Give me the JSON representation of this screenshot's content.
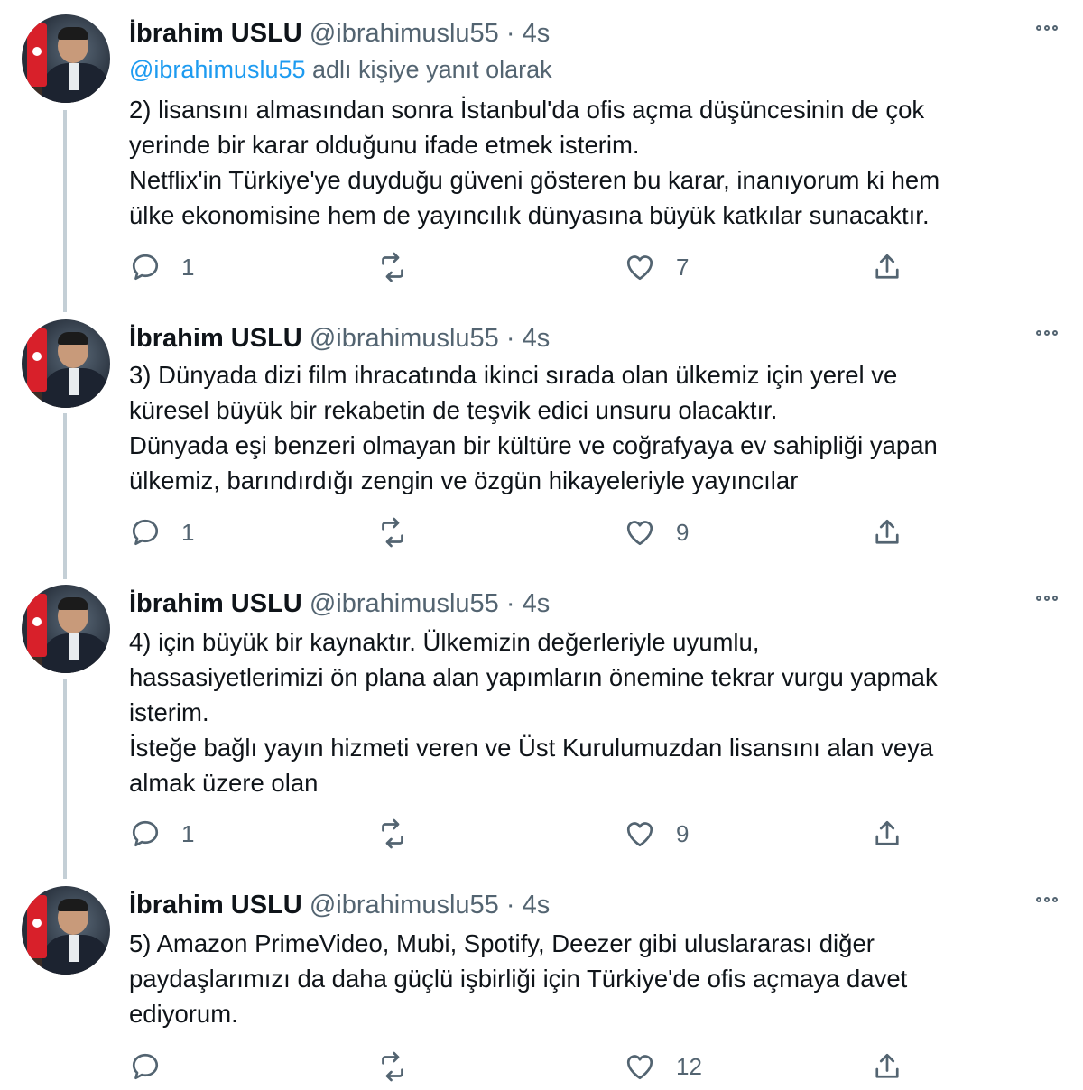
{
  "thread": {
    "tweets": [
      {
        "name": "İbrahim USLU",
        "handle": "@ibrahimuslu55",
        "separator": "·",
        "time": "4s",
        "reply_mention": "@ibrahimuslu55",
        "reply_suffix": "adlı kişiye yanıt olarak",
        "lines": [
          "2) lisansını almasından sonra İstanbul'da ofis açma düşüncesinin de çok",
          "yerinde bir karar olduğunu ifade etmek isterim.",
          "Netflix'in Türkiye'ye duyduğu güveni gösteren bu karar, inanıyorum ki hem",
          "ülke ekonomisine hem de yayıncılık dünyasına büyük katkılar sunacaktır."
        ],
        "replies": "1",
        "retweets": "",
        "likes": "7"
      },
      {
        "name": "İbrahim USLU",
        "handle": "@ibrahimuslu55",
        "separator": "·",
        "time": "4s",
        "lines": [
          "3) Dünyada dizi film ihracatında ikinci sırada olan ülkemiz için yerel ve",
          "küresel büyük bir rekabetin de teşvik edici unsuru olacaktır.",
          "Dünyada eşi benzeri olmayan bir kültüre ve coğrafyaya ev sahipliği yapan",
          "ülkemiz, barındırdığı zengin ve özgün hikayeleriyle yayıncılar"
        ],
        "replies": "1",
        "retweets": "",
        "likes": "9"
      },
      {
        "name": "İbrahim USLU",
        "handle": "@ibrahimuslu55",
        "separator": "·",
        "time": "4s",
        "lines": [
          "4) için büyük bir kaynaktır. Ülkemizin değerleriyle uyumlu,",
          "hassasiyetlerimizi ön plana alan yapımların önemine tekrar vurgu yapmak",
          "isterim.",
          "İsteğe bağlı yayın hizmeti veren ve Üst Kurulumuzdan lisansını alan veya",
          "almak üzere olan"
        ],
        "replies": "1",
        "retweets": "",
        "likes": "9"
      },
      {
        "name": "İbrahim USLU",
        "handle": "@ibrahimuslu55",
        "separator": "·",
        "time": "4s",
        "lines": [
          "5) Amazon PrimeVideo, Mubi, Spotify, Deezer gibi uluslararası diğer",
          "paydaşlarımızı da daha güçlü işbirliği için Türkiye'de ofis açmaya davet",
          "ediyorum."
        ],
        "replies": "",
        "retweets": "",
        "likes": "12"
      }
    ]
  },
  "icons": {
    "reply": "reply-icon",
    "retweet": "retweet-icon",
    "like": "heart-icon",
    "share": "share-icon",
    "more": "more-icon"
  },
  "colors": {
    "text": "#0f1419",
    "secondary": "#536471",
    "accent": "#1d9bf0",
    "thread_line": "#c4cfd6"
  }
}
